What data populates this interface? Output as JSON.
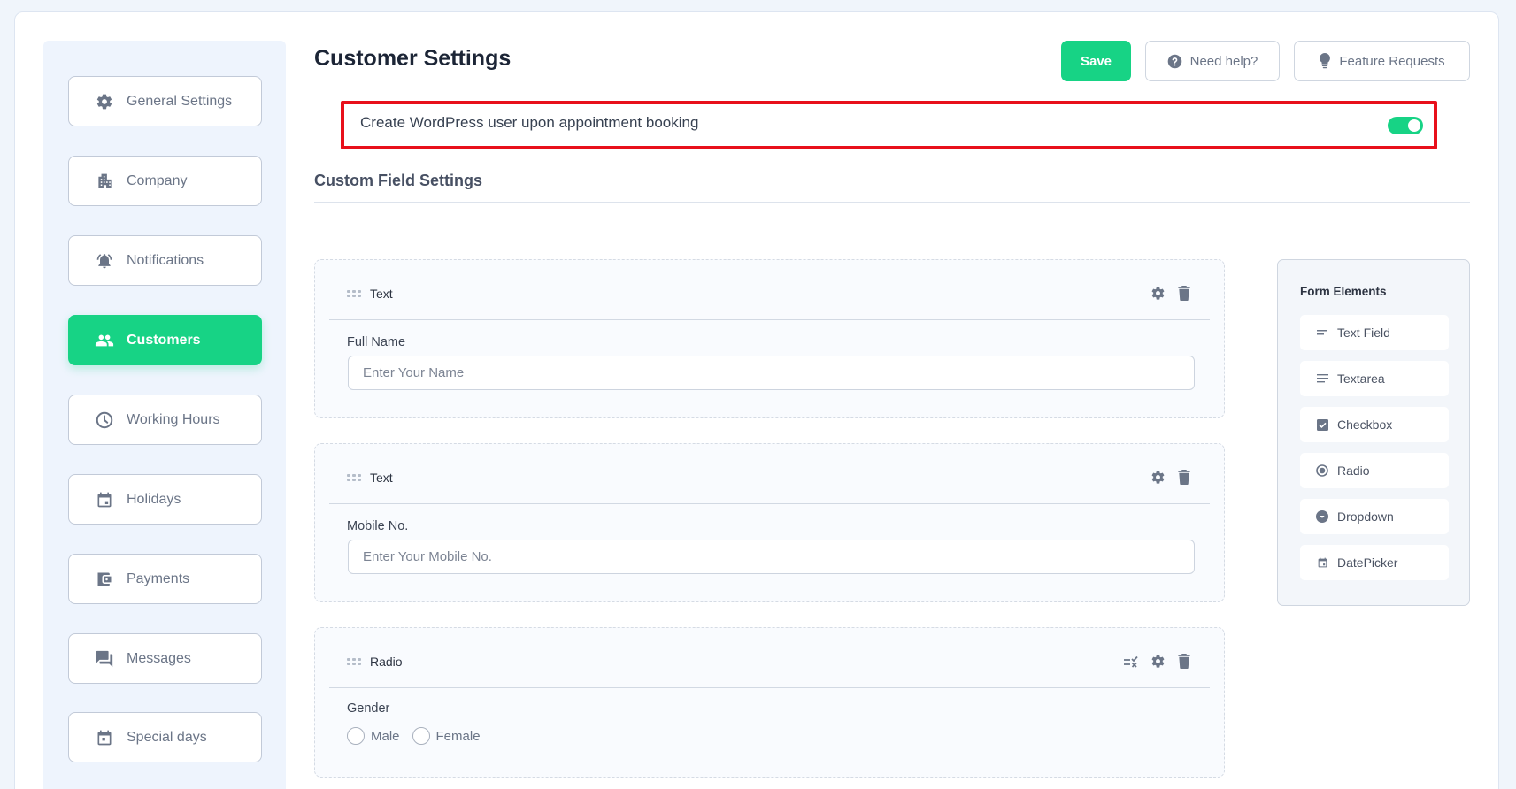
{
  "sidebar": {
    "items": [
      {
        "label": "General Settings",
        "icon": "gear-icon",
        "active": false
      },
      {
        "label": "Company",
        "icon": "building-icon",
        "active": false
      },
      {
        "label": "Notifications",
        "icon": "bell-ring-icon",
        "active": false
      },
      {
        "label": "Customers",
        "icon": "users-icon",
        "active": true
      },
      {
        "label": "Working Hours",
        "icon": "clock-icon",
        "active": false
      },
      {
        "label": "Holidays",
        "icon": "calendar-icon",
        "active": false
      },
      {
        "label": "Payments",
        "icon": "wallet-icon",
        "active": false
      },
      {
        "label": "Messages",
        "icon": "chat-icon",
        "active": false
      },
      {
        "label": "Special days",
        "icon": "calendar-icon",
        "active": false
      }
    ]
  },
  "header": {
    "title": "Customer Settings",
    "save_label": "Save",
    "help_label": "Need help?",
    "feature_label": "Feature Requests"
  },
  "wp_user": {
    "label": "Create WordPress user upon appointment booking",
    "enabled": true
  },
  "custom_fields": {
    "title": "Custom Field Settings",
    "fields": [
      {
        "type": "Text",
        "label": "Full Name",
        "placeholder": "Enter Your Name",
        "value": ""
      },
      {
        "type": "Text",
        "label": "Mobile No.",
        "placeholder": "Enter Your Mobile No.",
        "value": ""
      },
      {
        "type": "Radio",
        "label": "Gender",
        "options": [
          "Male",
          "Female"
        ]
      }
    ]
  },
  "form_elements": {
    "title": "Form Elements",
    "items": [
      {
        "label": "Text Field",
        "icon": "short-text-icon"
      },
      {
        "label": "Textarea",
        "icon": "paragraph-icon"
      },
      {
        "label": "Checkbox",
        "icon": "checkbox-icon"
      },
      {
        "label": "Radio",
        "icon": "radio-icon"
      },
      {
        "label": "Dropdown",
        "icon": "dropdown-icon"
      },
      {
        "label": "DatePicker",
        "icon": "calendar-icon"
      }
    ]
  },
  "colors": {
    "accent": "#17d385",
    "highlight": "#e8101b",
    "icon": "#6b7587"
  }
}
